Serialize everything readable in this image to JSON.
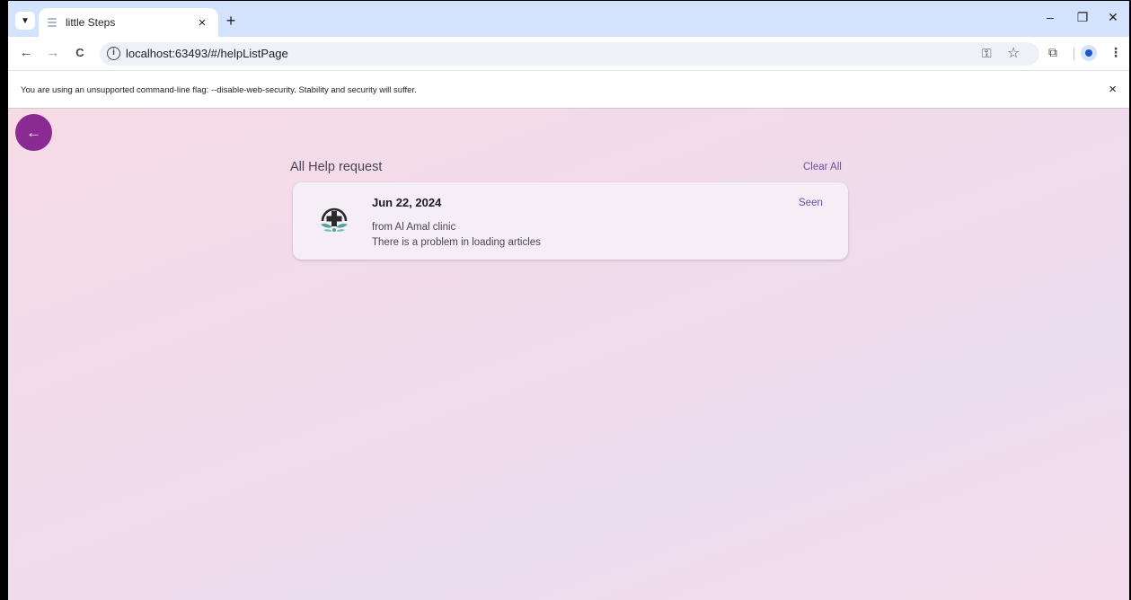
{
  "browser": {
    "tab_title": "little Steps",
    "tab_close": "×",
    "new_tab": "+",
    "url": "localhost:63493/#/helpListPage",
    "info_message": "You are using an unsupported command-line flag: --disable-web-security. Stability and security will suffer.",
    "info_close": "×",
    "controls": {
      "minimize": "–",
      "restore": "❐",
      "close": "✕"
    },
    "nav": {
      "back": "←",
      "forward": "→",
      "reload": "C"
    },
    "icons": [
      "key-icon",
      "star-icon",
      "extensions-icon",
      "profile-icon",
      "menu-icon"
    ]
  },
  "app": {
    "back_glyph": "←",
    "list_title": "All Help request",
    "clear_all_label": "Clear All",
    "requests": [
      {
        "date": "Jun 22, 2024",
        "from": "from Al Amal clinic",
        "message": "There is a problem in loading articles",
        "status": "Seen",
        "icon": "clinic-logo-icon"
      }
    ]
  },
  "colors": {
    "accent": "#8a2b94",
    "link": "#6b4fa0",
    "tab_strip": "#d3e3fd",
    "card": "#f6eef7"
  }
}
